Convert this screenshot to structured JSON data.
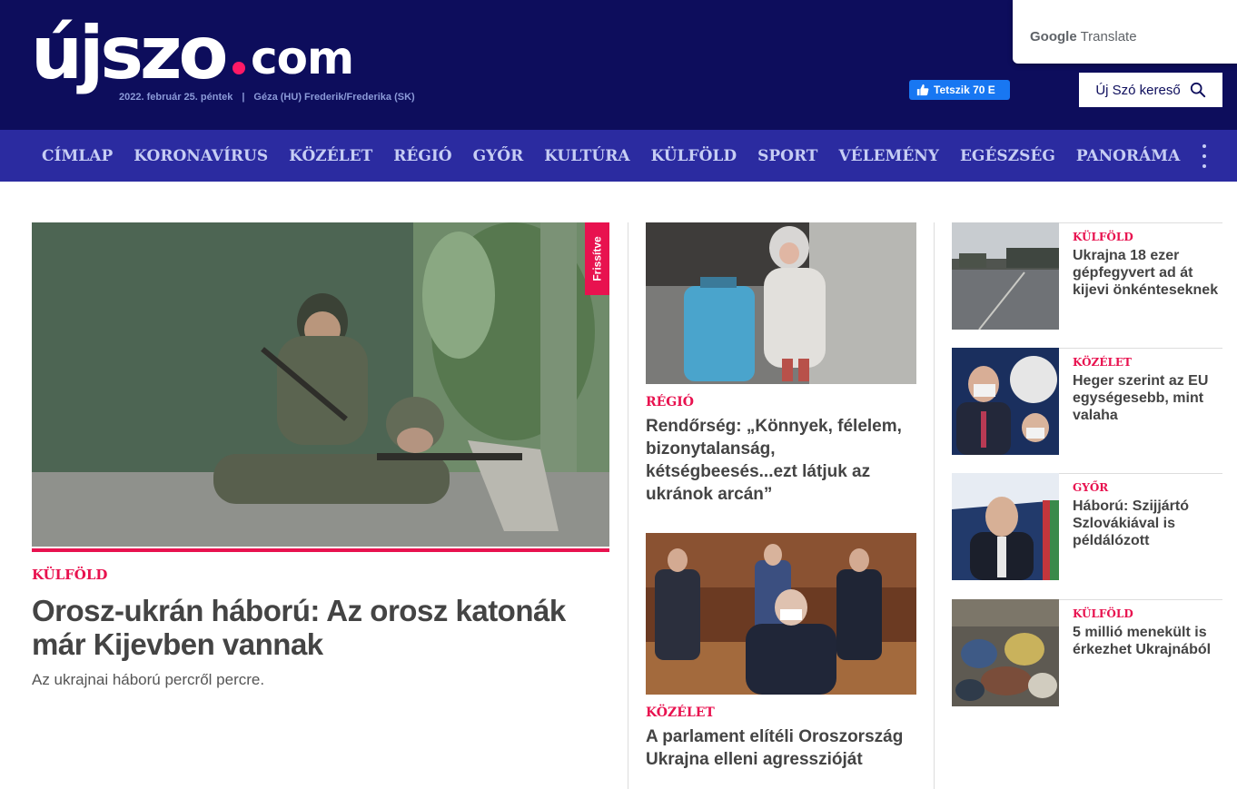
{
  "header": {
    "logo_main": "újszo",
    "logo_tld": "com",
    "date": "2022. február 25. péntek",
    "separator": "|",
    "nameday": "Géza (HU) Frederik/Frederika (SK)",
    "fb_like_label": "Tetszik 70 E",
    "google_translate_brand": "Google",
    "google_translate_label": "Translate",
    "search_label": "Új Szó kereső"
  },
  "nav": {
    "items": [
      "CÍMLAP",
      "KORONAVÍRUS",
      "KÖZÉLET",
      "RÉGIÓ",
      "GYŐR",
      "KULTÚRA",
      "KÜLFÖLD",
      "SPORT",
      "VÉLEMÉNY",
      "EGÉSZSÉG",
      "PANORÁMA"
    ]
  },
  "lead": {
    "badge": "Frissítve",
    "category": "KÜLFÖLD",
    "title": "Orosz-ukrán háború: Az orosz katonák már Kijevben vannak",
    "subtitle": "Az ukrajnai háború percről percre."
  },
  "middle": [
    {
      "category": "RÉGIÓ",
      "title": "Rendőrség: „Könnyek, félelem, bizonytalanság, kétségbeesés...ezt látjuk az ukránok arcán”"
    },
    {
      "category": "KÖZÉLET",
      "title": "A parlament elítéli Oroszország Ukrajna elleni agresszióját"
    }
  ],
  "side": [
    {
      "category": "KÜLFÖLD",
      "title": "Ukrajna 18 ezer gépfegyvert ad át kijevi önkénteseknek"
    },
    {
      "category": "KÖZÉLET",
      "title": "Heger szerint az EU egységesebb, mint valaha"
    },
    {
      "category": "GYŐR",
      "title": "Háború: Szijjártó Szlovákiával is példálózott"
    },
    {
      "category": "KÜLFÖLD",
      "title": "5 millió menekült is érkezhet Ukrajnából"
    }
  ],
  "colors": {
    "header_bg": "#0d0d5c",
    "nav_bg": "#2b2ba0",
    "accent": "#e8124f",
    "fb_blue": "#1877f2"
  }
}
